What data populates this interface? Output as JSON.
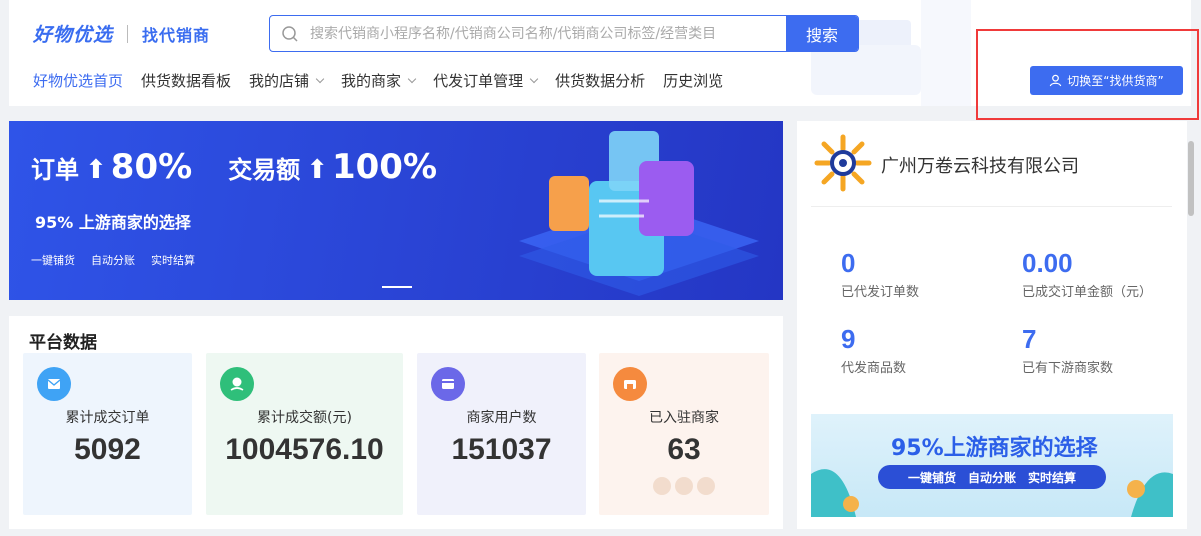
{
  "header": {
    "logo_main": "好物优选",
    "logo_sub": "找代销商",
    "search_placeholder": "搜索代销商小程序名称/代销商公司名称/代销商公司标签/经营类目",
    "search_button": "搜索",
    "switch_button": "切换至“找供货商”"
  },
  "nav": {
    "items": [
      {
        "label": "好物优选首页",
        "active": true,
        "dropdown": false
      },
      {
        "label": "供货数据看板",
        "active": false,
        "dropdown": false
      },
      {
        "label": "我的店铺",
        "active": false,
        "dropdown": true
      },
      {
        "label": "我的商家",
        "active": false,
        "dropdown": true
      },
      {
        "label": "代发订单管理",
        "active": false,
        "dropdown": true
      },
      {
        "label": "供货数据分析",
        "active": false,
        "dropdown": false
      },
      {
        "label": "历史浏览",
        "active": false,
        "dropdown": false
      }
    ]
  },
  "banner": {
    "order_label": "订单",
    "order_value": "80%",
    "amount_label": "交易额",
    "amount_value": "100%",
    "subtitle": "95% 上游商家的选择",
    "features": [
      "一键铺货",
      "自动分账",
      "实时结算"
    ]
  },
  "platform": {
    "title": "平台数据",
    "stats": [
      {
        "label": "累计成交订单",
        "value": "5092",
        "bg": "#eef5fd",
        "icon_color": "#3fa3f5",
        "icon": "envelope-icon"
      },
      {
        "label": "累计成交额(元)",
        "value": "1004576.10",
        "bg": "#eef8f2",
        "icon_color": "#2fbf7a",
        "icon": "money-icon"
      },
      {
        "label": "商家用户数",
        "value": "151037",
        "bg": "#f0f1fb",
        "icon_color": "#6b68e8",
        "icon": "card-icon"
      },
      {
        "label": "已入驻商家",
        "value": "63",
        "bg": "#fdf3ee",
        "icon_color": "#f58a3e",
        "icon": "store-icon"
      }
    ]
  },
  "company": {
    "name": "广州万卷云科技有限公司",
    "metrics": [
      {
        "value": "0",
        "label": "已代发订单数"
      },
      {
        "value": "0.00",
        "label": "已成交订单金额（元）"
      },
      {
        "value": "9",
        "label": "代发商品数"
      },
      {
        "value": "7",
        "label": "已有下游商家数"
      }
    ],
    "promo_title": "95%上游商家的选择",
    "promo_features": [
      "一键铺货",
      "自动分账",
      "实时结算"
    ]
  },
  "colors": {
    "accent": "#3d6cf0",
    "highlight": "#f03a3a"
  }
}
